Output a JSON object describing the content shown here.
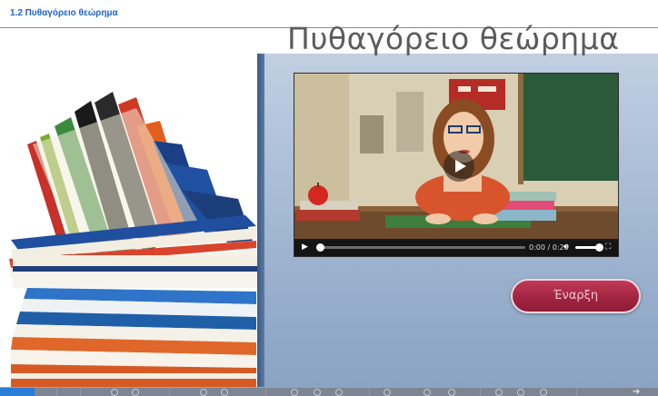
{
  "header": {
    "title": "1.2 Πυθαγόρειο θεώρημα"
  },
  "slide": {
    "title": "Πυθαγόρειο θεώρημα",
    "start_label": "Έναρξη"
  },
  "video": {
    "time": "0:00 / 0:20",
    "progress_fraction": 0.0,
    "volume_fraction": 1.0
  },
  "nav": {
    "next_icon": "arrow-right-icon"
  },
  "colors": {
    "header_title": "#1f63c9",
    "start_button": "#a12540",
    "nav_progress": "#2a7dd8",
    "panel_background": "#a9bdd7"
  }
}
